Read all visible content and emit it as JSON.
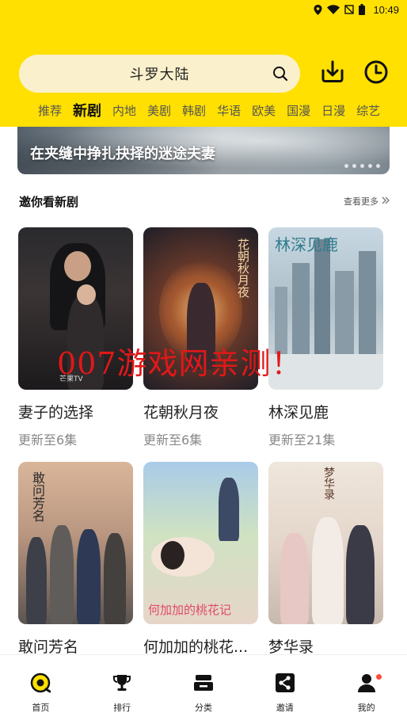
{
  "status_bar": {
    "time": "10:49"
  },
  "search": {
    "query": "斗罗大陆"
  },
  "tabs": [
    "推荐",
    "新剧",
    "内地",
    "美剧",
    "韩剧",
    "华语",
    "欧美",
    "国漫",
    "日漫",
    "综艺"
  ],
  "active_tab": 1,
  "banner": {
    "title": "在夹缝中挣扎抉择的迷途夫妻"
  },
  "section": {
    "title": "邀你看新剧",
    "see_more": "查看更多"
  },
  "cards": [
    {
      "title": "妻子的选择",
      "subtitle": "更新至6集",
      "poster_text": "芒果TV"
    },
    {
      "title": "花朝秋月夜",
      "subtitle": "更新至6集",
      "poster_text": "花朝秋月夜"
    },
    {
      "title": "林深见鹿",
      "subtitle": "更新至21集",
      "poster_text": "林深见鹿"
    },
    {
      "title": "敢问芳名",
      "subtitle": "",
      "poster_text": "敢问芳名"
    },
    {
      "title": "何加加的桃花...",
      "subtitle": "",
      "poster_text": "何加加的桃花记"
    },
    {
      "title": "梦华录",
      "subtitle": "",
      "poster_text": "梦华录"
    }
  ],
  "watermark": "007游戏网亲测！",
  "bottom_nav": [
    {
      "label": "首页",
      "icon": "home-icon"
    },
    {
      "label": "排行",
      "icon": "trophy-icon"
    },
    {
      "label": "分类",
      "icon": "category-icon"
    },
    {
      "label": "邀请",
      "icon": "share-icon"
    },
    {
      "label": "我的",
      "icon": "user-icon"
    }
  ],
  "colors": {
    "brand_yellow": "#ffe000",
    "search_bg": "#fbf0cc",
    "watermark_red": "#e01818",
    "badge_red": "#ff4a3d"
  }
}
